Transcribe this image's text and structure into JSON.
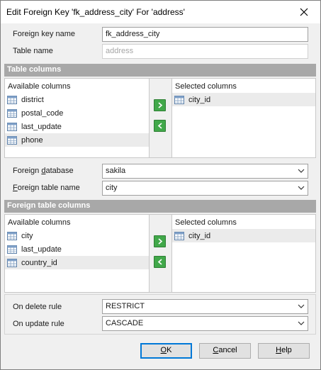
{
  "window": {
    "title": "Edit Foreign Key 'fk_address_city' For 'address'"
  },
  "form": {
    "fk_name_label": "Foreign key name",
    "fk_name_value": "fk_address_city",
    "table_name_label": "Table name",
    "table_name_value": "address"
  },
  "table_columns": {
    "header": "Table columns",
    "available_caption": "Available columns",
    "selected_caption": "Selected columns",
    "available": [
      "district",
      "postal_code",
      "last_update",
      "phone"
    ],
    "selected": [
      "city_id"
    ]
  },
  "foreign": {
    "database_label_pre": "Foreign ",
    "database_label_ul": "d",
    "database_label_post": "atabase",
    "database_value": "sakila",
    "table_label_pre": "",
    "table_label_ul": "F",
    "table_label_post": "oreign table name",
    "table_value": "city"
  },
  "foreign_columns": {
    "header": "Foreign table columns",
    "available_caption": "Available columns",
    "selected_caption": "Selected columns",
    "available": [
      "city",
      "last_update",
      "country_id"
    ],
    "selected": [
      "city_id"
    ]
  },
  "rules": {
    "on_delete_label": "On delete rule",
    "on_delete_value": "RESTRICT",
    "on_update_label": "On update rule",
    "on_update_value": "CASCADE"
  },
  "buttons": {
    "ok_ul": "O",
    "ok_post": "K",
    "cancel_ul": "C",
    "cancel_post": "ancel",
    "help_ul": "H",
    "help_post": "elp"
  },
  "colors": {
    "section_header": "#a8a8a8",
    "arrow_button": "#41a84a",
    "default_button_border": "#0078d7"
  },
  "icons": {
    "close": "close-icon",
    "table_column": "table-column-icon",
    "move_right": "arrow-right-icon",
    "move_left": "arrow-left-icon",
    "dropdown": "chevron-down-icon"
  }
}
